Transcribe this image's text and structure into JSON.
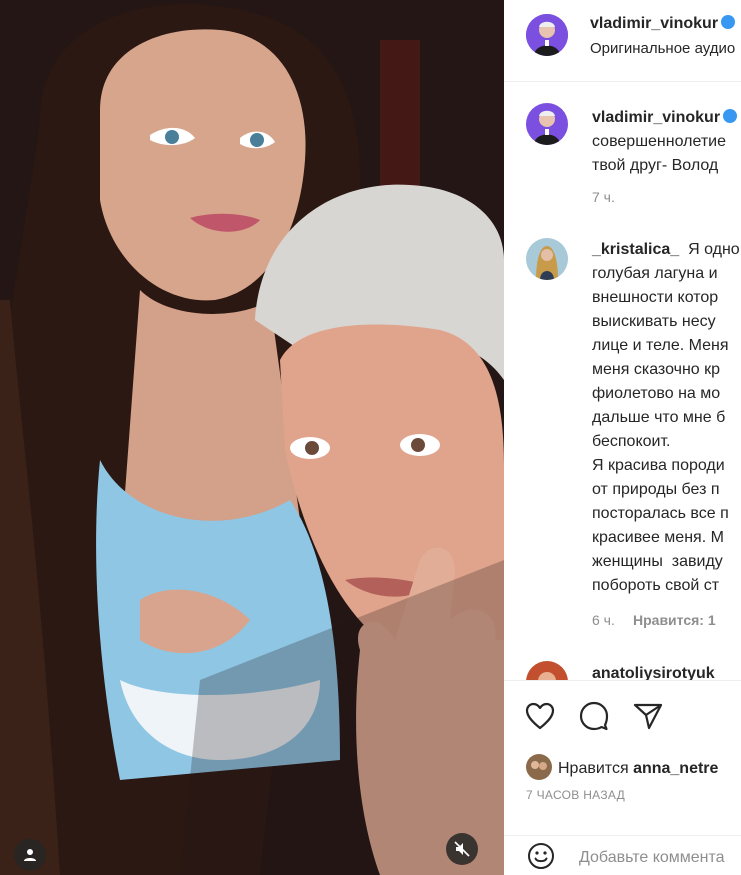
{
  "header": {
    "username": "vladimir_vinokur",
    "audio": "Оригинальное аудио"
  },
  "comments": [
    {
      "username": "vladimir_vinokur",
      "lines": [
        "совершеннолетие",
        "твой друг- Волод"
      ],
      "time": "7 ч."
    },
    {
      "username": "_kristalica_",
      "first_line": "Я одно",
      "lines": [
        "голубая лагуна и",
        "внешности котор",
        "выискивать несу",
        "лице и теле. Меня",
        "меня сказочно кр",
        "фиолетово на мо",
        "дальше что мне б",
        "беспокоит.",
        "Я красива породи",
        "от природы без п",
        "посторалась все п",
        "красивее меня. М",
        "женщины  завиду",
        "побороть свой ст"
      ],
      "time": "6 ч.",
      "likes": "Нравится: 1"
    },
    {
      "username": "anatoliysirotyuk"
    }
  ],
  "actions": {
    "likes_prefix": "Нравится",
    "likes_user": "anna_netre",
    "time_ago": "7 ЧАСОВ НАЗАД",
    "comment_placeholder": "Добавьте коммента"
  },
  "icons": [
    "user-icon",
    "mute-icon",
    "heart-icon",
    "comment-icon",
    "share-icon",
    "emoji-icon",
    "verified-icon"
  ],
  "colors": {
    "verified": "#3897f0",
    "muted_text": "#8e8e8e",
    "border": "#efefef"
  }
}
